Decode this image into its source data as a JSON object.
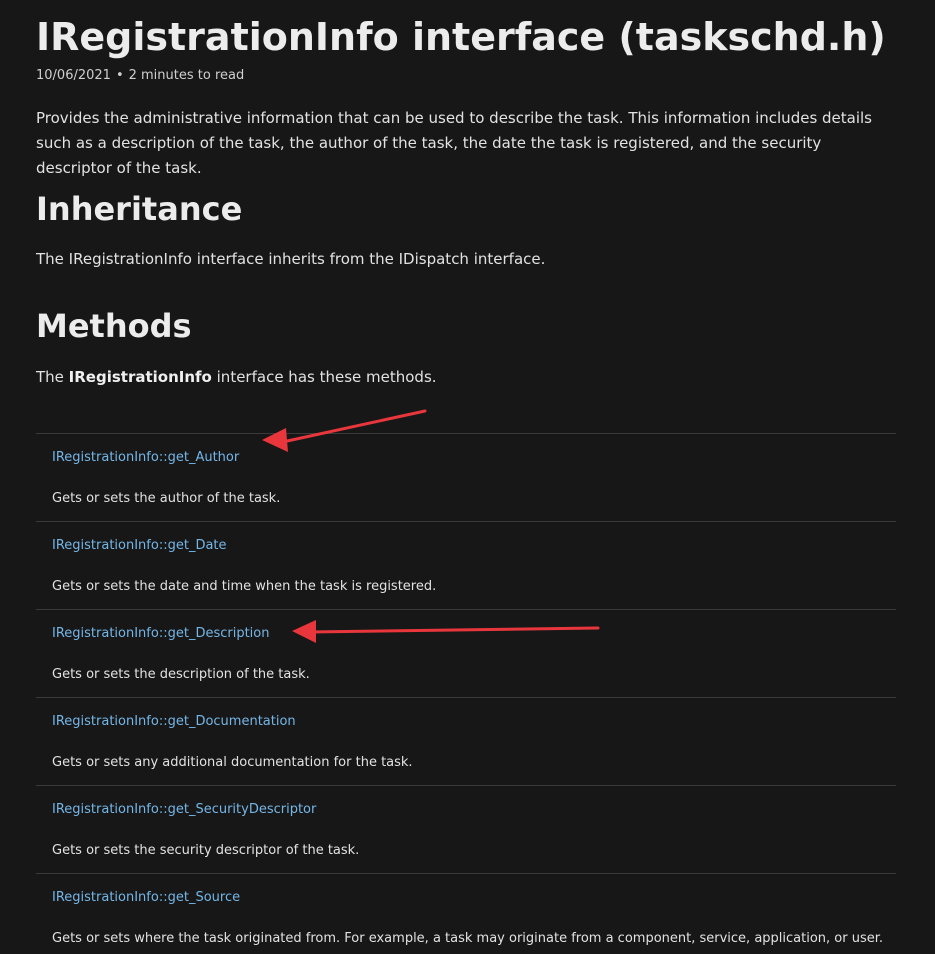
{
  "title": "IRegistrationInfo interface (taskschd.h)",
  "meta": {
    "date": "10/06/2021",
    "separator": "•",
    "read_time": "2 minutes to read"
  },
  "intro": "Provides the administrative information that can be used to describe the task. This information includes details such as a description of the task, the author of the task, the date the task is registered, and the security descriptor of the task.",
  "inheritance": {
    "heading": "Inheritance",
    "text": "The IRegistrationInfo interface inherits from the IDispatch interface."
  },
  "methods": {
    "heading": "Methods",
    "text_prefix": "The ",
    "text_bold": "IRegistrationInfo",
    "text_suffix": " interface has these methods.",
    "items": [
      {
        "name": "IRegistrationInfo::get_Author",
        "desc": "Gets or sets the author of the task."
      },
      {
        "name": "IRegistrationInfo::get_Date",
        "desc": "Gets or sets the date and time when the task is registered."
      },
      {
        "name": "IRegistrationInfo::get_Description",
        "desc": "Gets or sets the description of the task."
      },
      {
        "name": "IRegistrationInfo::get_Documentation",
        "desc": "Gets or sets any additional documentation for the task."
      },
      {
        "name": "IRegistrationInfo::get_SecurityDescriptor",
        "desc": "Gets or sets the security descriptor of the task."
      },
      {
        "name": "IRegistrationInfo::get_Source",
        "desc": "Gets or sets where the task originated from. For example, a task may originate from a component, service, application, or user."
      }
    ]
  },
  "colors": {
    "background": "#171717",
    "link": "#75b6e7",
    "annotation_arrow": "#e8363c"
  }
}
